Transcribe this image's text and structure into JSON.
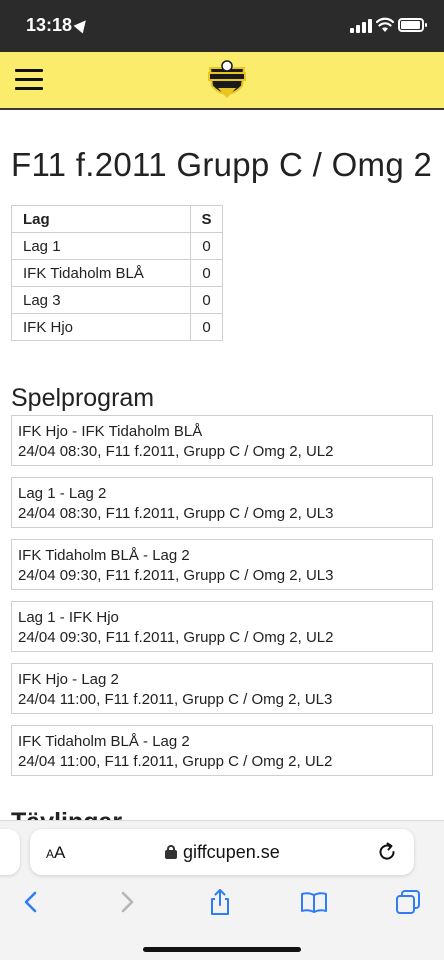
{
  "status_bar": {
    "time": "13:18"
  },
  "header": {
    "logo_icon": "giffcupen-logo",
    "menu_icon": "hamburger-menu-icon",
    "accent": "#fcec6b"
  },
  "page": {
    "title": "F11 f.2011 Grupp C / Omg 2"
  },
  "standings": {
    "headers": [
      "Lag",
      "S"
    ],
    "rows": [
      [
        "Lag 1",
        "0"
      ],
      [
        "IFK Tidaholm BLÅ",
        "0"
      ],
      [
        "Lag 3",
        "0"
      ],
      [
        "IFK Hjo",
        "0"
      ]
    ]
  },
  "schedule": {
    "heading": "Spelprogram",
    "matches": [
      {
        "teams": "IFK Hjo - IFK Tidaholm BLÅ",
        "details": "24/04 08:30, F11 f.2011, Grupp C / Omg 2, UL2"
      },
      {
        "teams": "Lag 1 - Lag 2",
        "details": "24/04 08:30, F11 f.2011, Grupp C / Omg 2, UL3"
      },
      {
        "teams": "IFK Tidaholm BLÅ - Lag 2",
        "details": "24/04 09:30, F11 f.2011, Grupp C / Omg 2, UL3"
      },
      {
        "teams": "Lag 1 - IFK Hjo",
        "details": "24/04 09:30, F11 f.2011, Grupp C / Omg 2, UL2"
      },
      {
        "teams": "IFK Hjo - Lag 2",
        "details": "24/04 11:00, F11 f.2011, Grupp C / Omg 2, UL3"
      },
      {
        "teams": "IFK Tidaholm BLÅ - Lag 2",
        "details": "24/04 11:00, F11 f.2011, Grupp C / Omg 2, UL2"
      }
    ]
  },
  "next_section": {
    "heading_partial": "Tävlingar"
  },
  "browser": {
    "aa_label_small": "A",
    "aa_label_large": "A",
    "url": "giffcupen.se",
    "icons": [
      "back-icon",
      "forward-icon",
      "share-icon",
      "bookmarks-icon",
      "tabs-icon",
      "reload-icon",
      "lock-icon"
    ]
  }
}
